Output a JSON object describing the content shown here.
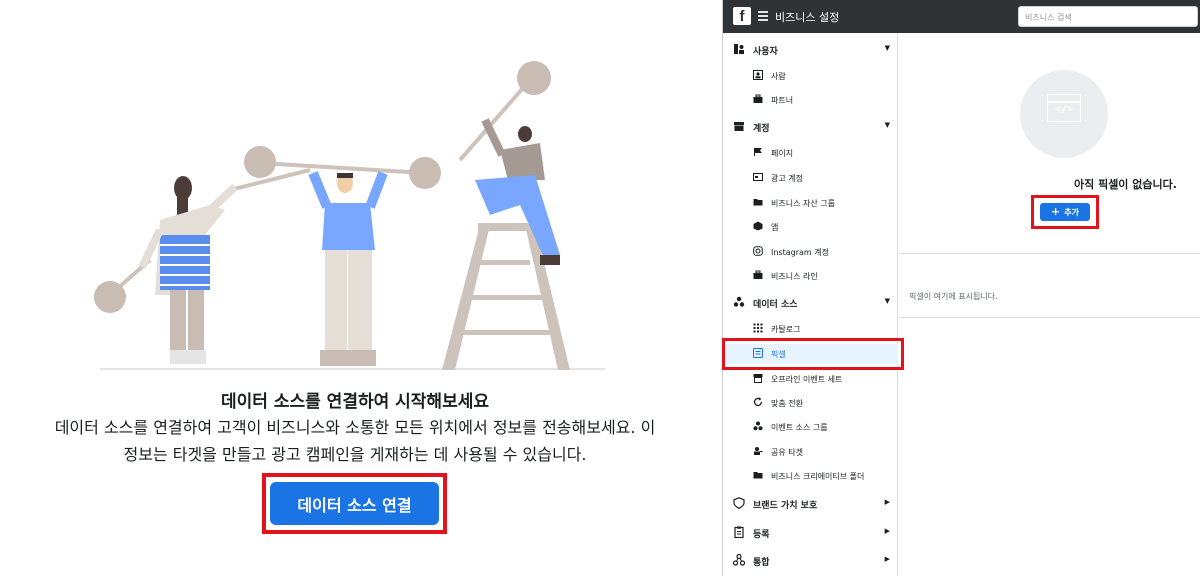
{
  "left_panel": {
    "headline": "데이터 소스를 연결하여 시작해보세요",
    "description_line1": "데이터 소스를 연결하여 고객이 비즈니스와 소통한 모든 위치에서 정보를 전송해보세요. 이",
    "description_line2": "정보는 타겟을 만들고 광고 캠페인을 게재하는 데 사용될 수 있습니다.",
    "cta_label": "데이터 소스 연결",
    "accent_color": "#1b74e4",
    "highlight_color": "#e4131b"
  },
  "topbar": {
    "logo_letter": "f",
    "title": "비즈니스 설정",
    "search_placeholder": "비즈니스 검색"
  },
  "sidebar": {
    "sections": [
      {
        "label": "사용자",
        "icon": "users-icon",
        "expanded": true,
        "items": [
          {
            "label": "사람",
            "icon": "person-icon"
          },
          {
            "label": "파트너",
            "icon": "briefcase-icon"
          }
        ]
      },
      {
        "label": "계정",
        "icon": "archive-icon",
        "expanded": true,
        "items": [
          {
            "label": "페이지",
            "icon": "flag-icon"
          },
          {
            "label": "광고 계정",
            "icon": "ad-icon"
          },
          {
            "label": "비즈니스 자산 그룹",
            "icon": "folder-icon"
          },
          {
            "label": "앱",
            "icon": "cube-icon"
          },
          {
            "label": "Instagram 계정",
            "icon": "instagram-icon"
          },
          {
            "label": "비즈니스 라인",
            "icon": "briefcase-icon"
          }
        ]
      },
      {
        "label": "데이터 소스",
        "icon": "data-sources-icon",
        "expanded": true,
        "items": [
          {
            "label": "카탈로그",
            "icon": "grid-icon"
          },
          {
            "label": "픽셀",
            "icon": "pixel-icon",
            "active": true
          },
          {
            "label": "오프라인 이벤트 세트",
            "icon": "store-icon"
          },
          {
            "label": "맞춤 전환",
            "icon": "refresh-icon"
          },
          {
            "label": "이벤트 소스 그룹",
            "icon": "source-group-icon"
          },
          {
            "label": "공유 타겟",
            "icon": "share-user-icon"
          },
          {
            "label": "비즈니스 크리에이티브 폴더",
            "icon": "folder-icon"
          }
        ]
      },
      {
        "label": "브랜드 가치 보호",
        "icon": "shield-icon",
        "expanded": false,
        "items": []
      },
      {
        "label": "등록",
        "icon": "clipboard-icon",
        "expanded": false,
        "items": []
      },
      {
        "label": "통합",
        "icon": "integration-icon",
        "expanded": false,
        "items": []
      }
    ]
  },
  "main": {
    "empty_title": "아직 픽셀이 없습니다.",
    "code_glyph": "</>",
    "add_label": "추가",
    "add_icon": "plus-icon",
    "pixel_note": "픽셀이 여기에 표시됩니다."
  }
}
